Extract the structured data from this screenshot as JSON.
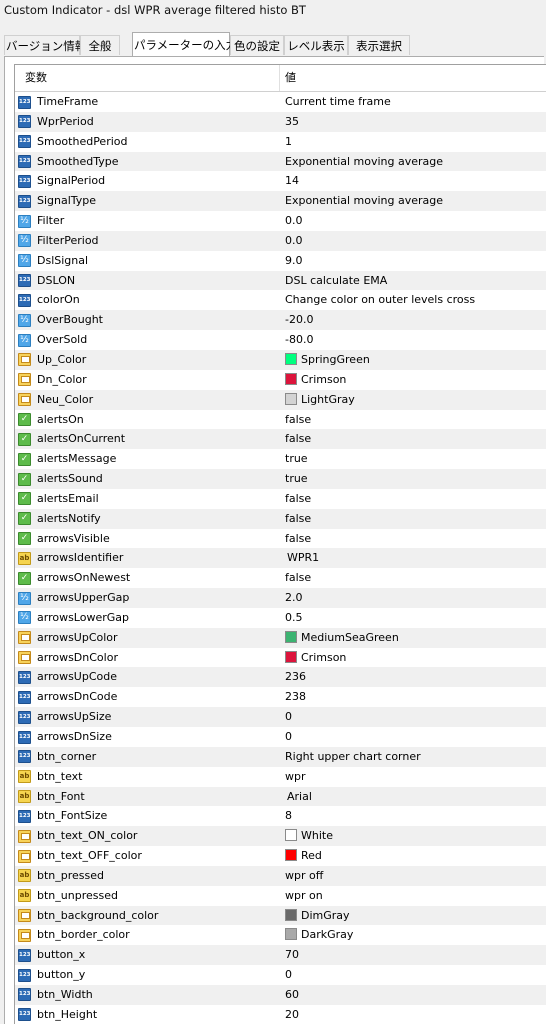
{
  "window": {
    "title": "Custom Indicator - dsl WPR  average filtered histo BT"
  },
  "tabs": [
    {
      "label": "バージョン情報",
      "active": false
    },
    {
      "label": "全般",
      "active": false
    },
    {
      "label": "パラメーターの入力",
      "active": true
    },
    {
      "label": "色の設定",
      "active": false
    },
    {
      "label": "レベル表示",
      "active": false
    },
    {
      "label": "表示選択",
      "active": false
    }
  ],
  "table": {
    "headers": {
      "name": "変数",
      "value": "値"
    },
    "rows": [
      {
        "type": "int",
        "name": "TimeFrame",
        "value": "Current time frame"
      },
      {
        "type": "int",
        "name": "WprPeriod",
        "value": "35"
      },
      {
        "type": "int",
        "name": "SmoothedPeriod",
        "value": "1"
      },
      {
        "type": "int",
        "name": "SmoothedType",
        "value": "Exponential moving average"
      },
      {
        "type": "int",
        "name": "SignalPeriod",
        "value": "14"
      },
      {
        "type": "int",
        "name": "SignalType",
        "value": "Exponential moving average"
      },
      {
        "type": "double",
        "name": "Filter",
        "value": "0.0"
      },
      {
        "type": "double",
        "name": "FilterPeriod",
        "value": "0.0"
      },
      {
        "type": "double",
        "name": "DslSignal",
        "value": "9.0"
      },
      {
        "type": "int",
        "name": "DSLON",
        "value": "DSL calculate EMA"
      },
      {
        "type": "int",
        "name": "colorOn",
        "value": "Change color on outer levels cross"
      },
      {
        "type": "double",
        "name": "OverBought",
        "value": "-20.0"
      },
      {
        "type": "double",
        "name": "OverSold",
        "value": "-80.0"
      },
      {
        "type": "color",
        "name": "Up_Color",
        "value": "SpringGreen",
        "swatch": "#00ff7f"
      },
      {
        "type": "color",
        "name": "Dn_Color",
        "value": "Crimson",
        "swatch": "#dc143c"
      },
      {
        "type": "color",
        "name": "Neu_Color",
        "value": "LightGray",
        "swatch": "#d3d3d3"
      },
      {
        "type": "bool",
        "name": "alertsOn",
        "value": "false"
      },
      {
        "type": "bool",
        "name": "alertsOnCurrent",
        "value": "false"
      },
      {
        "type": "bool",
        "name": "alertsMessage",
        "value": "true"
      },
      {
        "type": "bool",
        "name": "alertsSound",
        "value": "true"
      },
      {
        "type": "bool",
        "name": "alertsEmail",
        "value": "false"
      },
      {
        "type": "bool",
        "name": "alertsNotify",
        "value": "false"
      },
      {
        "type": "bool",
        "name": "arrowsVisible",
        "value": "false"
      },
      {
        "type": "string",
        "name": "arrowsIdentifier",
        "value": "WPR1"
      },
      {
        "type": "bool",
        "name": "arrowsOnNewest",
        "value": "false"
      },
      {
        "type": "double",
        "name": "arrowsUpperGap",
        "value": "2.0"
      },
      {
        "type": "double",
        "name": "arrowsLowerGap",
        "value": "0.5"
      },
      {
        "type": "color",
        "name": "arrowsUpColor",
        "value": "MediumSeaGreen",
        "swatch": "#3cb371"
      },
      {
        "type": "color",
        "name": "arrowsDnColor",
        "value": "Crimson",
        "swatch": "#dc143c"
      },
      {
        "type": "int",
        "name": "arrowsUpCode",
        "value": "236"
      },
      {
        "type": "int",
        "name": "arrowsDnCode",
        "value": "238"
      },
      {
        "type": "int",
        "name": "arrowsUpSize",
        "value": "0"
      },
      {
        "type": "int",
        "name": "arrowsDnSize",
        "value": "0"
      },
      {
        "type": "int",
        "name": "btn_corner",
        "value": "Right upper chart corner"
      },
      {
        "type": "string",
        "name": "btn_text",
        "value": "wpr"
      },
      {
        "type": "string",
        "name": "btn_Font",
        "value": "Arial"
      },
      {
        "type": "int",
        "name": "btn_FontSize",
        "value": "8"
      },
      {
        "type": "color",
        "name": "btn_text_ON_color",
        "value": "White",
        "swatch": "#ffffff"
      },
      {
        "type": "color",
        "name": "btn_text_OFF_color",
        "value": "Red",
        "swatch": "#ff0000"
      },
      {
        "type": "string",
        "name": "btn_pressed",
        "value": "wpr off"
      },
      {
        "type": "string",
        "name": "btn_unpressed",
        "value": "wpr on"
      },
      {
        "type": "color",
        "name": "btn_background_color",
        "value": "DimGray",
        "swatch": "#696969"
      },
      {
        "type": "color",
        "name": "btn_border_color",
        "value": "DarkGray",
        "swatch": "#a9a9a9"
      },
      {
        "type": "int",
        "name": "button_x",
        "value": "70"
      },
      {
        "type": "int",
        "name": "button_y",
        "value": "0"
      },
      {
        "type": "int",
        "name": "btn_Width",
        "value": "60"
      },
      {
        "type": "int",
        "name": "btn_Height",
        "value": "20"
      }
    ]
  }
}
